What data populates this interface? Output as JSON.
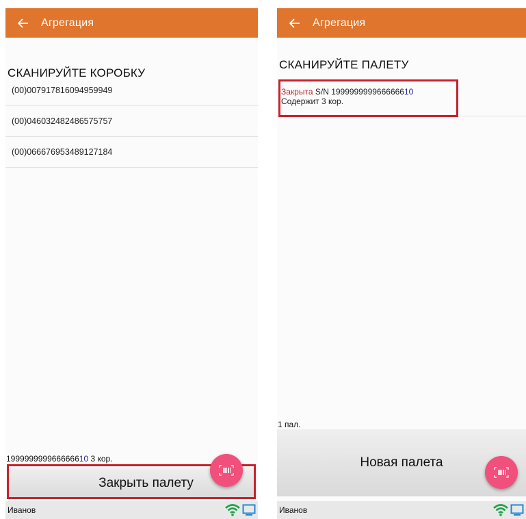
{
  "screens": [
    {
      "appbar": {
        "title": "Агрегация"
      },
      "prompt": "СКАНИРУЙТЕ КОРОБКУ",
      "boxes": [
        "(00)007917816094959949",
        "(00)046032482486575757",
        "(00)066676953489127184"
      ],
      "footer": {
        "serial_main": "1999999999666666",
        "serial_tail": "10",
        "count": " 3 кор."
      },
      "action_button": "Закрыть палету",
      "bottom_bar": {
        "user": "Иванов"
      }
    },
    {
      "appbar": {
        "title": "Агрегация"
      },
      "prompt": "СКАНИРУЙТЕ ПАЛЕТУ",
      "pallet": {
        "status": "Закрыта",
        "serial_main": " S/N 1999999999666666",
        "serial_tail": "10",
        "contents": "Содержит 3 кор."
      },
      "footer": {
        "pallets": "1 пал."
      },
      "action_button": "Новая палета",
      "bottom_bar": {
        "user": "Иванов"
      }
    }
  ],
  "colors": {
    "appbar": "#e0762e",
    "fab": "#f0507b",
    "highlight_box": "#c7222b",
    "closed_text": "#b0302f",
    "wifi": "#1fa34a",
    "monitor": "#1e88d6"
  },
  "icons": [
    "arrow-back-icon",
    "barcode-scan-icon",
    "wifi-icon",
    "monitor-icon"
  ]
}
